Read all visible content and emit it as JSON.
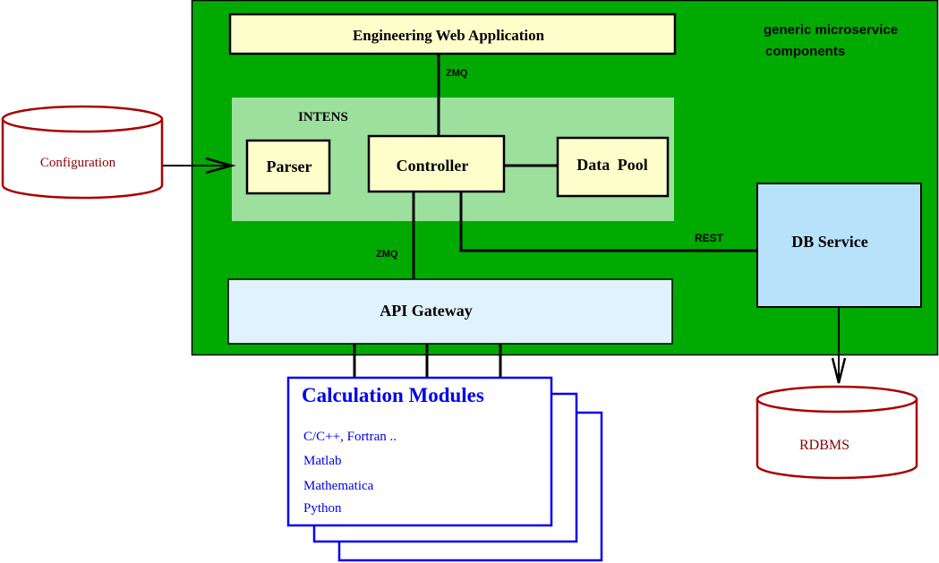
{
  "colors": {
    "outer_bg": "#00aa00",
    "intens_bg": "#9ddf9d",
    "component_fill": "#ffffcc",
    "gateway_fill": "#e0f2fe",
    "db_service_fill": "#b8e2fb",
    "database_stroke": "#aa0000",
    "database_text": "#8b0000",
    "modules_color": "#0000ee",
    "line": "#000000"
  },
  "container": {
    "label_line1": "generic microservice",
    "label_line2": "components"
  },
  "web_app": {
    "label": "Engineering Web Application"
  },
  "intens": {
    "label": "INTENS",
    "parser": "Parser",
    "controller": "Controller",
    "data_pool": "Data Pool"
  },
  "api_gateway": {
    "label": "API Gateway"
  },
  "db_service": {
    "label": "DB Service"
  },
  "config_db": {
    "label": "Configuration"
  },
  "rdbms": {
    "label": "RDBMS"
  },
  "calc_modules": {
    "title": "Calculation Modules",
    "items": [
      "C/C++, Fortran ..",
      "Matlab",
      "Mathematica",
      "Python"
    ]
  },
  "connections": {
    "webapp_controller": "ZMQ",
    "controller_gateway": "ZMQ",
    "controller_dbservice": "REST"
  }
}
